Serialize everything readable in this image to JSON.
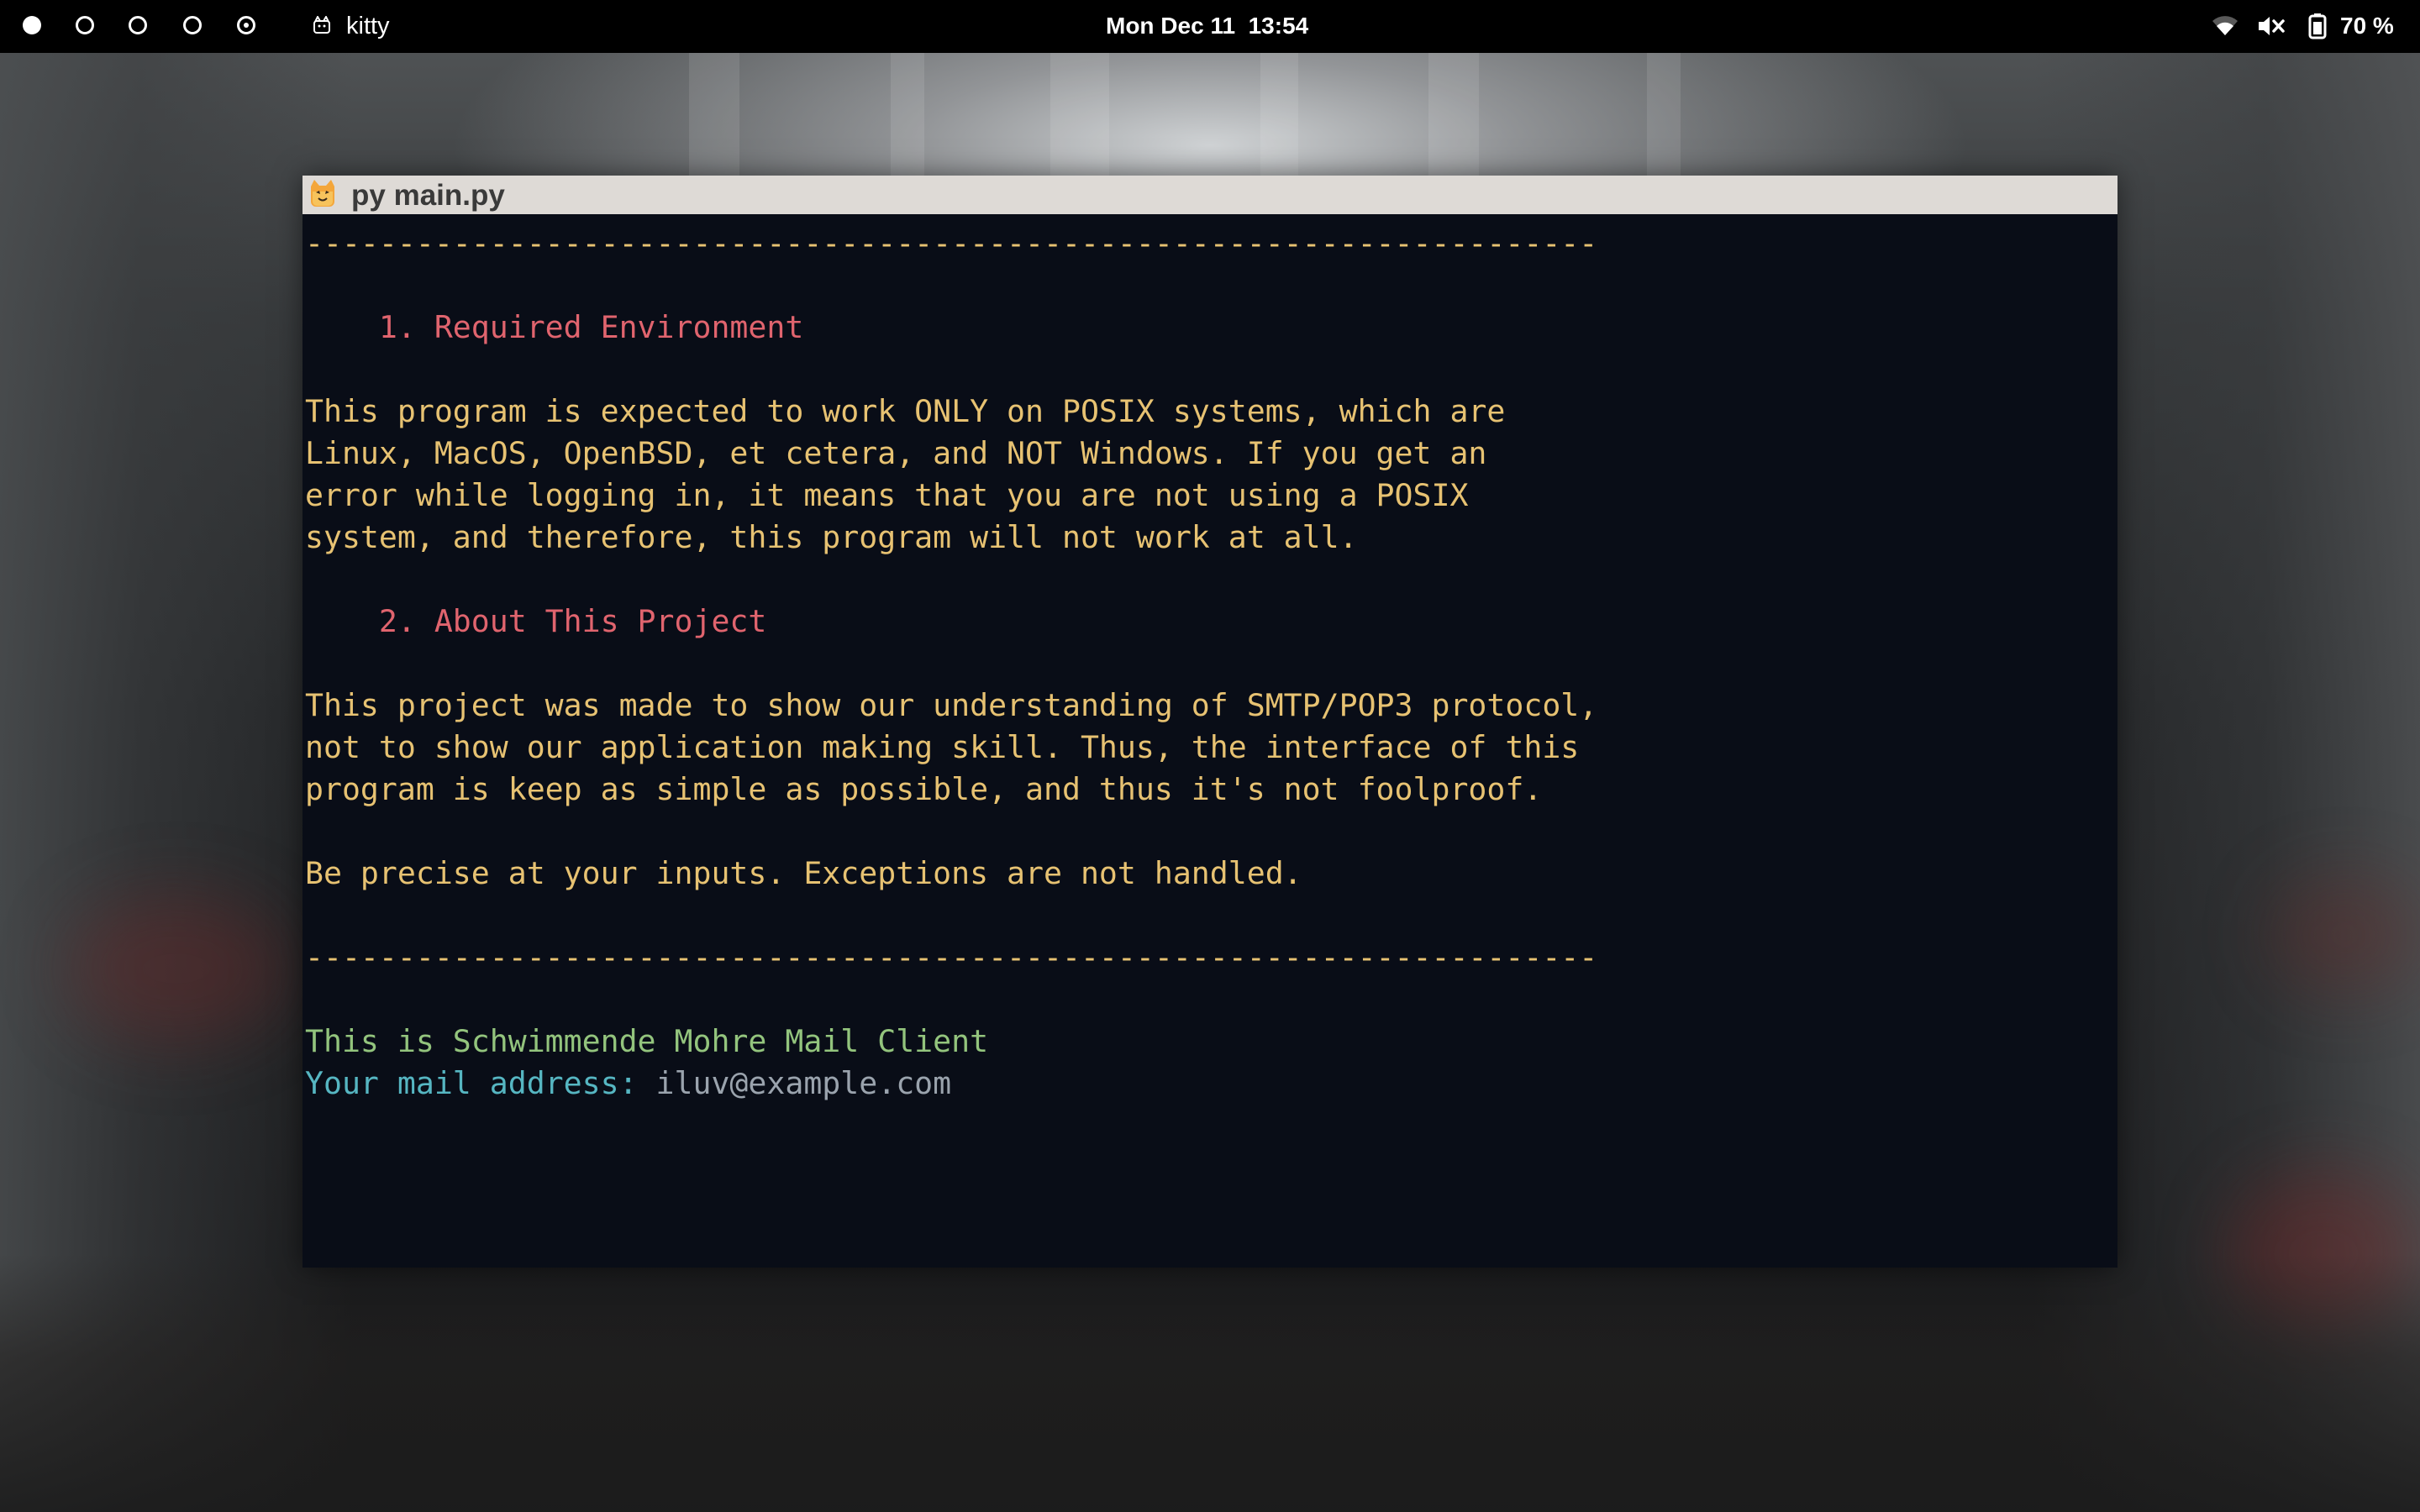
{
  "topbar": {
    "workspaces": [
      {
        "name": "workspace-1",
        "state": "filled"
      },
      {
        "name": "workspace-2",
        "state": "empty"
      },
      {
        "name": "workspace-3",
        "state": "empty"
      },
      {
        "name": "workspace-4",
        "state": "empty"
      },
      {
        "name": "workspace-5",
        "state": "current"
      }
    ],
    "app_name": "kitty",
    "clock": "Mon Dec 11  13:54",
    "tray": {
      "wifi_icon": "wifi-icon",
      "volume_icon": "volume-muted-icon",
      "battery_icon": "battery-icon",
      "battery_percent": "70 %"
    }
  },
  "window": {
    "title": "py main.py",
    "title_icon": "kitty-cat-icon"
  },
  "terminal": {
    "separator_top": "----------------------------------------------------------------------",
    "section1_heading": "    1. Required Environment",
    "section1_lines": [
      "This program is expected to work ONLY on POSIX systems, which are",
      "Linux, MacOS, OpenBSD, et cetera, and NOT Windows. If you get an",
      "error while logging in, it means that you are not using a POSIX",
      "system, and therefore, this program will not work at all."
    ],
    "section2_heading": "    2. About This Project",
    "section2_lines": [
      "This project was made to show our understanding of SMTP/POP3 protocol,",
      "not to show our application making skill. Thus, the interface of this",
      "program is keep as simple as possible, and thus it's not foolproof."
    ],
    "warning_line": "Be precise at your inputs. Exceptions are not handled.",
    "separator_bottom": "----------------------------------------------------------------------",
    "client_intro": "This is Schwimmende Mohre Mail Client",
    "prompt_label": "Your mail address: ",
    "prompt_value": "iluv@example.com"
  },
  "colors": {
    "terminal_bg": "#090d17",
    "text_yellow": "#e7c272",
    "heading_red": "#e0646e",
    "intro_green": "#93c47d",
    "prompt_cyan": "#56b6c2",
    "titlebar_bg": "#dedad6"
  }
}
